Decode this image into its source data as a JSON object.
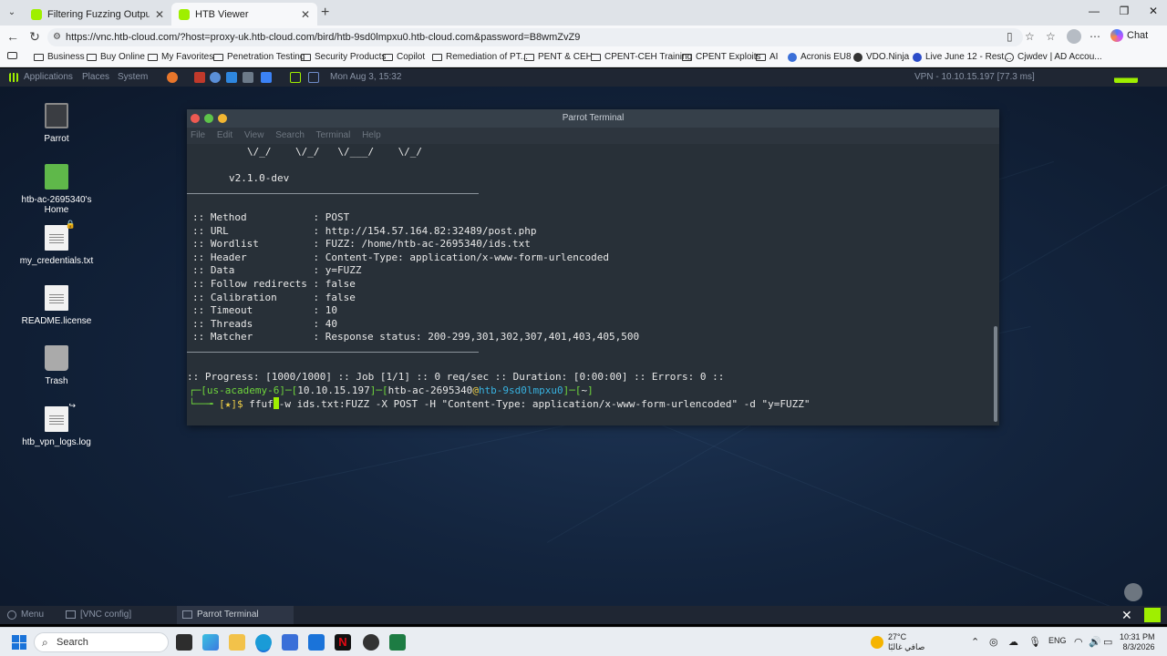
{
  "browser": {
    "tabs": [
      {
        "title": "Filtering Fuzzing Output | Hack Th",
        "active": false
      },
      {
        "title": "HTB Viewer",
        "active": true
      }
    ],
    "url": "https://vnc.htb-cloud.com/?host=proxy-uk.htb-cloud.com/bird/htb-9sd0lmpxu0.htb-cloud.com&password=B8wmZvZ9",
    "chat_label": "Chat",
    "bookmarks": [
      "Business",
      "Buy Online",
      "My Favorites",
      "Penetration Testing",
      "Security Products",
      "Copilot",
      "Remediation of PT...",
      "PENT & CEH",
      "CPENT-CEH Training",
      "CPENT Exploits",
      "AI",
      "Acronis EU8",
      "VDO.Ninja",
      "Live June 12 - Rest...",
      "Cjwdev | AD Accou..."
    ]
  },
  "parrot_top_panel": {
    "applications": "Applications",
    "places": "Places",
    "system": "System",
    "datetime": "Mon Aug 3, 15:32",
    "vpn": "VPN - 10.10.15.197 [77.3 ms]"
  },
  "desktop_icons": [
    {
      "label": "Parrot"
    },
    {
      "label": "htb-ac-2695340's Home"
    },
    {
      "label": "my_credentials.txt"
    },
    {
      "label": "README.license"
    },
    {
      "label": "Trash"
    },
    {
      "label": "htb_vpn_logs.log"
    }
  ],
  "terminal": {
    "title": "Parrot Terminal",
    "menu": [
      "File",
      "Edit",
      "View",
      "Search",
      "Terminal",
      "Help"
    ],
    "banner_line": "\\/_/    \\/_/   \\/___/    \\/_/",
    "version": "v2.1.0-dev",
    "config": [
      {
        "key": ":: Method           :",
        "value": "POST"
      },
      {
        "key": ":: URL              :",
        "value": "http://154.57.164.82:32489/post.php"
      },
      {
        "key": ":: Wordlist         :",
        "value": "FUZZ: /home/htb-ac-2695340/ids.txt"
      },
      {
        "key": ":: Header           :",
        "value": "Content-Type: application/x-www-form-urlencoded"
      },
      {
        "key": ":: Data             :",
        "value": "y=FUZZ"
      },
      {
        "key": ":: Follow redirects :",
        "value": "false"
      },
      {
        "key": ":: Calibration      :",
        "value": "false"
      },
      {
        "key": ":: Timeout          :",
        "value": "10"
      },
      {
        "key": ":: Threads          :",
        "value": "40"
      },
      {
        "key": ":: Matcher          :",
        "value": "Response status: 200-299,301,302,307,401,403,405,500"
      }
    ],
    "progress": ":: Progress: [1000/1000] :: Job [1/1] :: 0 req/sec :: Duration: [0:00:00] :: Errors: 0 ::",
    "prompt": {
      "corner_top": "┌─[",
      "vpn_name": "us-academy-6",
      "mid1": "]─[",
      "ip": "10.10.15.197",
      "mid2": "]─[",
      "user": "htb-ac-2695340",
      "at": "@",
      "host": "htb-9sd0lmpxu0",
      "mid3": "]─[",
      "dir": "~",
      "end": "]",
      "corner_bottom": "└──╼",
      "marker": "[★]$",
      "cmd_before": "ffuf",
      "cmd_after": "-w ids.txt:FUZZ -X POST -H \"Content-Type: application/x-www-form-urlencoded\" -d \"y=FUZZ\""
    }
  },
  "parrot_bottom_panel": {
    "menu": "Menu",
    "vnc_config": "[VNC config]",
    "terminal_task": "Parrot Terminal"
  },
  "taskbar": {
    "search_placeholder": "Search",
    "weather_temp": "27°C",
    "weather_desc": "صافي غالبًا",
    "lang": "ENG",
    "time": "10:31 PM",
    "date": "8/3/2026"
  },
  "colors": {
    "terminal_bg": "#283038",
    "prompt_green": "#6fd53c",
    "prompt_cyan": "#38b2e0",
    "htb_green": "#9fef00"
  }
}
